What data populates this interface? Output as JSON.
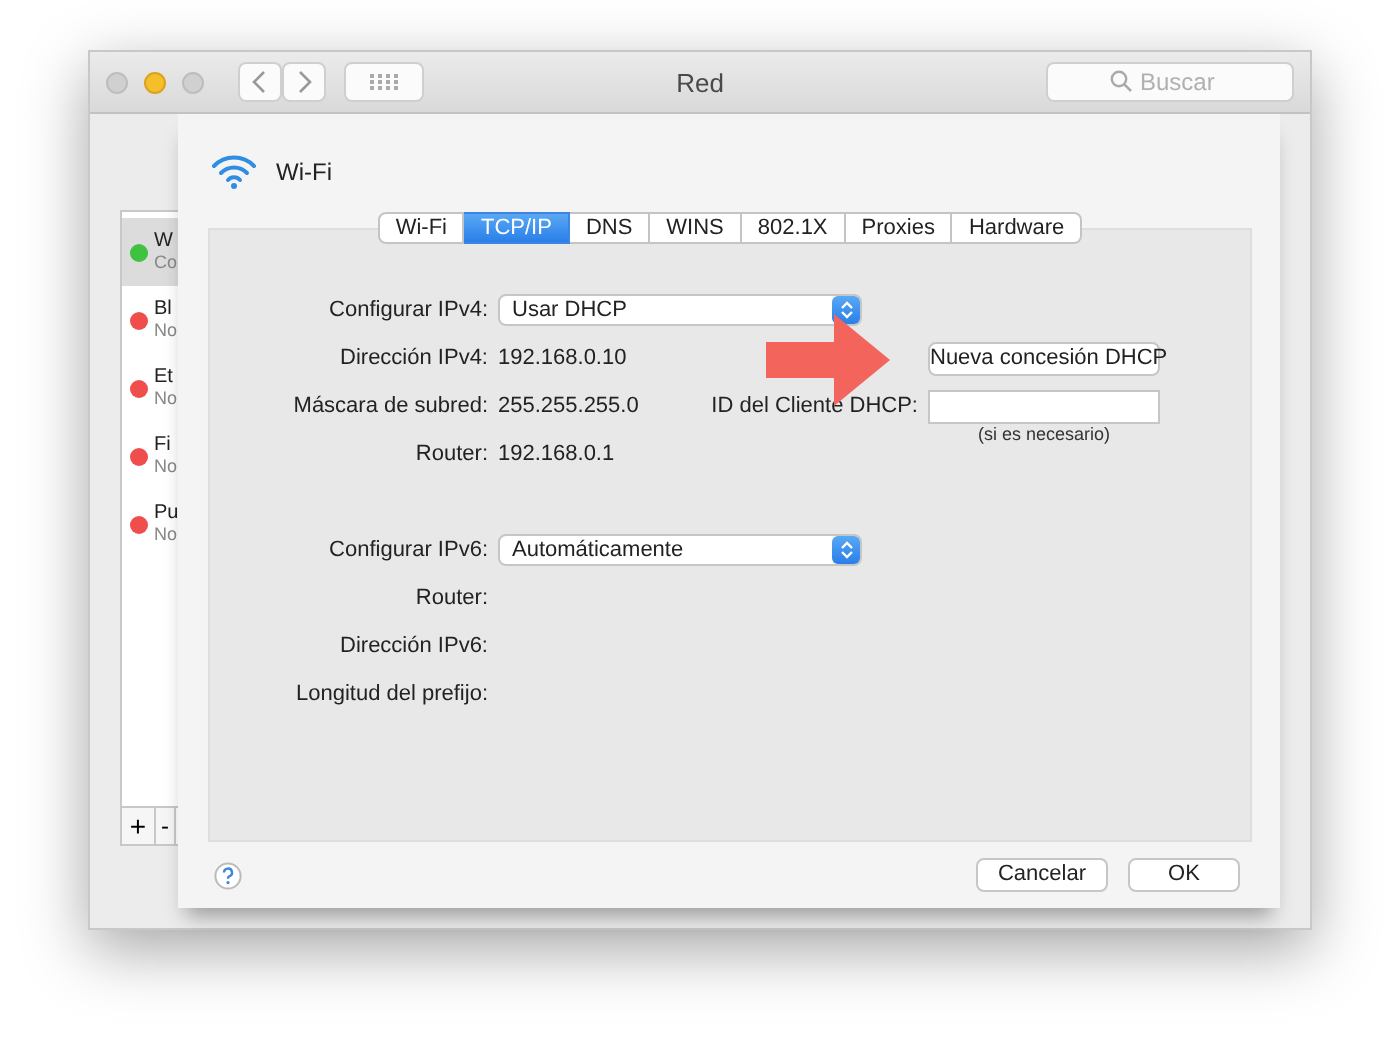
{
  "window": {
    "title": "Red"
  },
  "toolbar": {
    "search": {
      "placeholder": "Buscar"
    }
  },
  "sidebar": {
    "items": [
      {
        "name": "W",
        "status": "Co",
        "color": "#3fc23f",
        "selected": true
      },
      {
        "name": "Bl",
        "status": "No",
        "color": "#f04d4d",
        "selected": false
      },
      {
        "name": "Et",
        "status": "No",
        "color": "#f04d4d",
        "selected": false
      },
      {
        "name": "Fi",
        "status": "No",
        "color": "#f04d4d",
        "selected": false
      },
      {
        "name": "Pu",
        "status": "No",
        "color": "#f04d4d",
        "selected": false
      }
    ],
    "add_button": "+",
    "remove_button": "-"
  },
  "sheet": {
    "title": "Wi-Fi",
    "tabs": [
      {
        "label": "Wi-Fi",
        "selected": false
      },
      {
        "label": "TCP/IP",
        "selected": true
      },
      {
        "label": "DNS",
        "selected": false
      },
      {
        "label": "WINS",
        "selected": false
      },
      {
        "label": "802.1X",
        "selected": false
      },
      {
        "label": "Proxies",
        "selected": false
      },
      {
        "label": "Hardware",
        "selected": false
      }
    ],
    "ipv4": {
      "configure_label": "Configurar IPv4:",
      "configure_value": "Usar DHCP",
      "address_label": "Dirección IPv4:",
      "address": "192.168.0.10",
      "mask_label": "Máscara de subred:",
      "mask": "255.255.255.0",
      "router_label": "Router:",
      "router": "192.168.0.1",
      "renew_button": "Nueva concesión DHCP",
      "client_id_label": "ID del Cliente DHCP:",
      "client_id_hint": "(si es necesario)"
    },
    "ipv6": {
      "configure_label": "Configurar IPv6:",
      "configure_value": "Automáticamente",
      "router_label": "Router:",
      "address_label": "Dirección IPv6:",
      "prefix_label": "Longitud del prefijo:"
    },
    "buttons": [
      "Cancelar",
      "OK"
    ]
  }
}
